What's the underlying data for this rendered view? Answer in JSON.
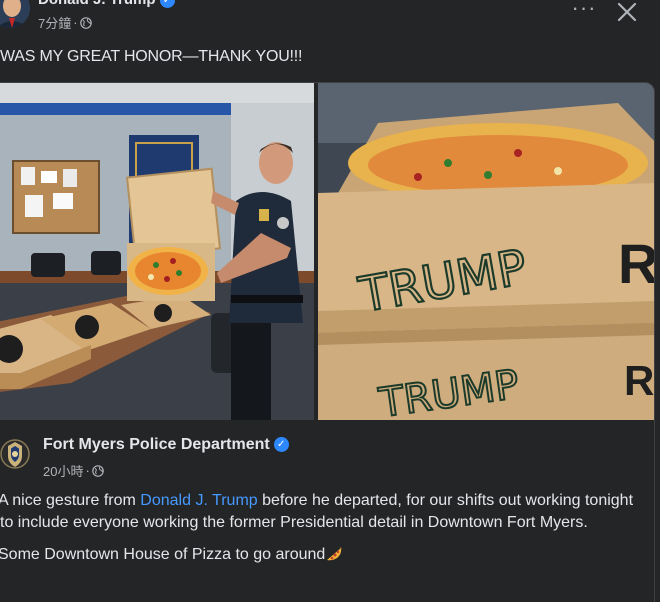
{
  "post": {
    "author": "Donald J. Trump",
    "time": "7分鐘",
    "separator": "·",
    "text": "WAS MY GREAT HONOR—THANK YOU!!!"
  },
  "actions": {
    "more_label": "···",
    "close_icon": "close-icon"
  },
  "shared": {
    "author": "Fort Myers Police Department",
    "time": "20小時",
    "separator": "·",
    "body_prefix": "A nice gesture from ",
    "mention": "Donald J. Trump",
    "body_suffix": " before he departed, for our shifts out working tonight to include everyone working the former Presidential detail in Downtown Fort Myers.",
    "body_line2": "Some Downtown House of Pizza to go around"
  },
  "photos": {
    "right_box_text_1": "TRUMP",
    "right_box_text_2": "TRUMP",
    "right_box_brand_1": "R",
    "right_box_brand_2": "R"
  },
  "colors": {
    "background": "#242526",
    "text": "#e4e6eb",
    "secondary": "#b0b3b8",
    "link": "#4599ff",
    "verified": "#2d88ff"
  }
}
